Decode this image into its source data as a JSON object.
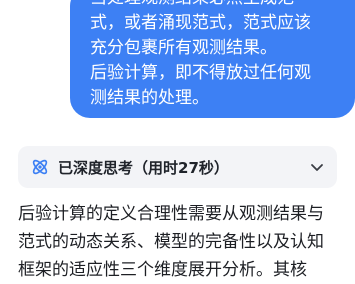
{
  "user_message": {
    "lines": [
      "当处理观测结果必然生成范",
      "式，或者涌现范式，范式应该",
      "充分包裹所有观测结果。",
      "后验计算，即不得放过任何观",
      "测结果的处理。"
    ]
  },
  "thinking": {
    "label": "已深度思考（用时27秒）",
    "icon": "atom-icon",
    "toggle_icon": "chevron-down-icon",
    "accent_color": "#3d80f4"
  },
  "answer": {
    "lines": [
      "后验计算的定义合理性需要从观测结果与",
      "范式的动态关系、模型的完备性以及认知",
      "框架的适应性三个维度展开分析。其核"
    ]
  }
}
